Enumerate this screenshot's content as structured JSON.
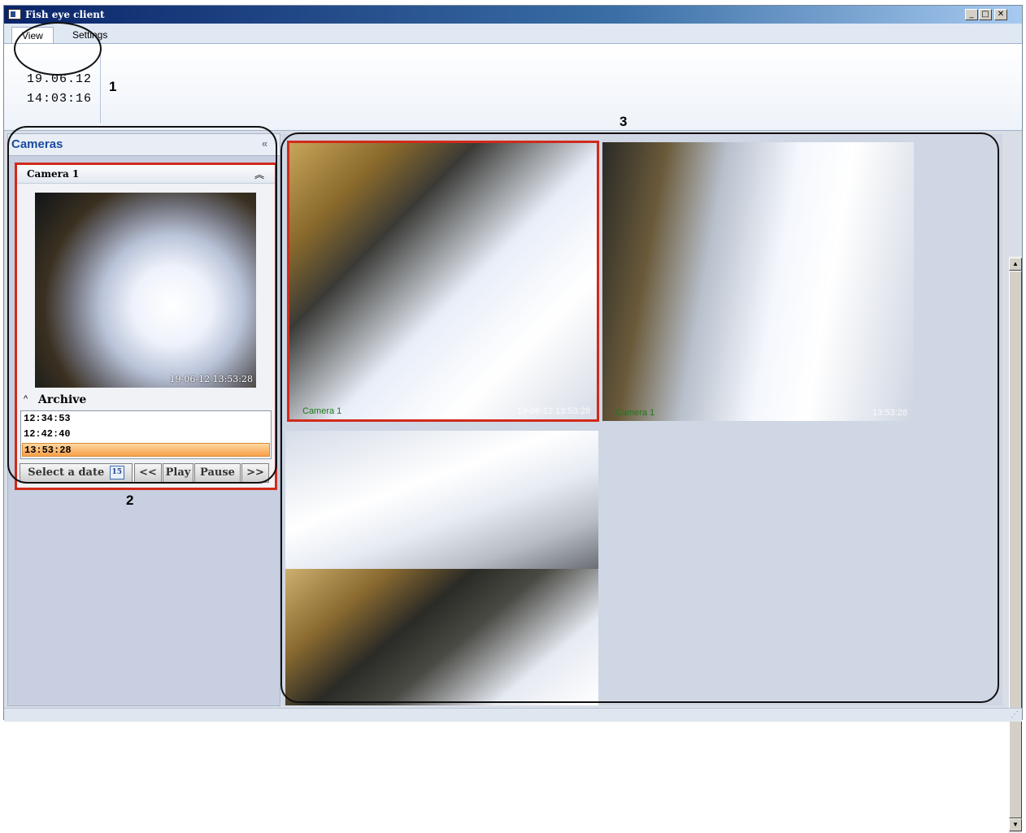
{
  "window": {
    "title": "Fish eye client"
  },
  "ribbon": {
    "tabs": [
      {
        "label": "View",
        "active": true
      },
      {
        "label": "Settings",
        "active": false
      }
    ],
    "date": "19.06.12",
    "time": "14:03:16"
  },
  "callouts": [
    "1",
    "2",
    "3"
  ],
  "cameras_panel": {
    "title": "Cameras",
    "collapse_icon": "double-chevron-left-icon",
    "camera": {
      "name": "Camera 1",
      "timestamp": "19-06-12 13:53:28"
    },
    "archive": {
      "title": "Archive",
      "entries": [
        "12:34:53",
        "12:42:40",
        "13:53:28"
      ],
      "selected_index": 2
    },
    "controls": {
      "select_date": "Select a date",
      "calendar_day": "15",
      "rewind": "<<",
      "play": "Play",
      "pause": "Pause",
      "forward": ">>"
    }
  },
  "views": [
    {
      "label": "Camera 1",
      "time": "19-06-12 13:53:28",
      "selected": true
    },
    {
      "label": "Camera 1",
      "time": "13:53:28",
      "selected": false
    },
    {
      "label": "",
      "time": "",
      "selected": false
    },
    {
      "label": "",
      "time": "",
      "selected": false
    }
  ],
  "colors": {
    "selection_border": "#d12a1a",
    "panel_header_text": "#1a4aa0",
    "archive_selected": "#f7a04a",
    "camera_label": "#1b7a1b"
  }
}
